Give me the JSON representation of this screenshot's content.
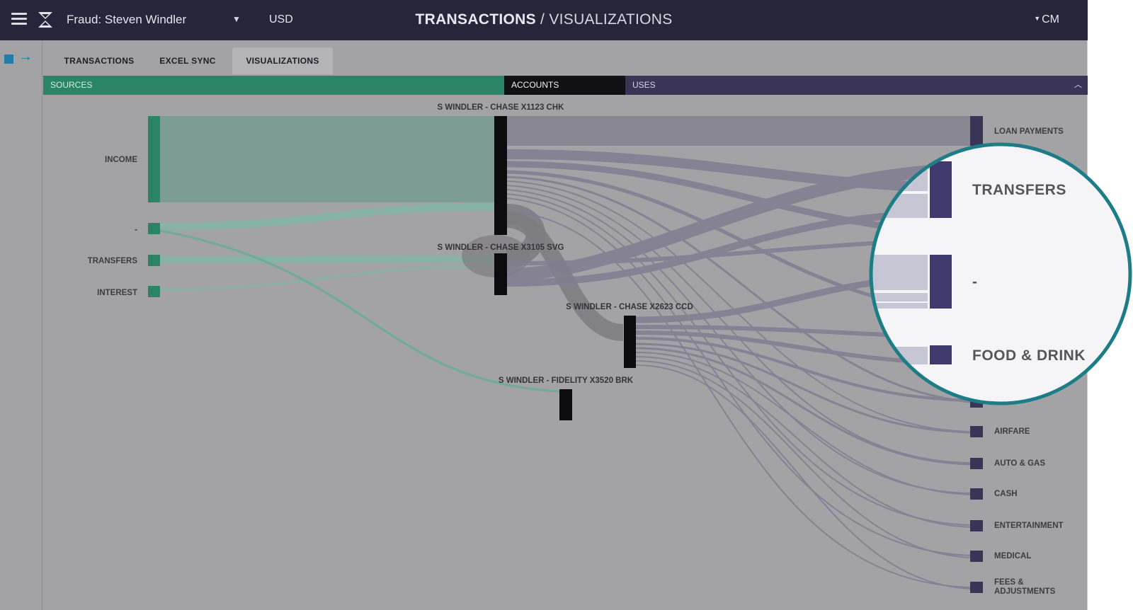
{
  "header": {
    "case_name": "Fraud: Steven Windler",
    "currency": "USD",
    "title_strong": "TRANSACTIONS",
    "title_sep": " / ",
    "title_rest": "VISUALIZATIONS",
    "user_initials": "CM"
  },
  "tabs": [
    {
      "label": "TRANSACTIONS",
      "active": false
    },
    {
      "label": "EXCEL SYNC",
      "active": false
    },
    {
      "label": "VISUALIZATIONS",
      "active": true
    }
  ],
  "bands": {
    "sources": "SOURCES",
    "accounts": "ACCOUNTS",
    "uses": "USES"
  },
  "icons": [
    "menu-icon",
    "logo-icon",
    "chevron-down-icon",
    "square-icon",
    "arrow-right-icon",
    "chevron-up-icon"
  ],
  "colors": {
    "source": "#2a8466",
    "account": "#0c0c0e",
    "use": "#3a3557",
    "magnifier_ring": "#1d7d86"
  },
  "chart_data": {
    "type": "sankey",
    "sources": [
      "INCOME",
      "-",
      "TRANSFERS",
      "INTEREST"
    ],
    "accounts": [
      "S WINDLER - CHASE X1123 CHK",
      "S WINDLER - CHASE X3105 SVG",
      "S WINDLER - CHASE X2623 CCD",
      "S WINDLER - FIDELITY X3520 BRK"
    ],
    "uses_visible": [
      "LOAN PAYMENTS",
      "AIRFARE",
      "AUTO & GAS",
      "CASH",
      "ENTERTAINMENT",
      "MEDICAL",
      "FEES & ADJUSTMENTS"
    ],
    "uses_magnified": [
      "TRANSFERS",
      "-",
      "FOOD & DRINK"
    ]
  }
}
